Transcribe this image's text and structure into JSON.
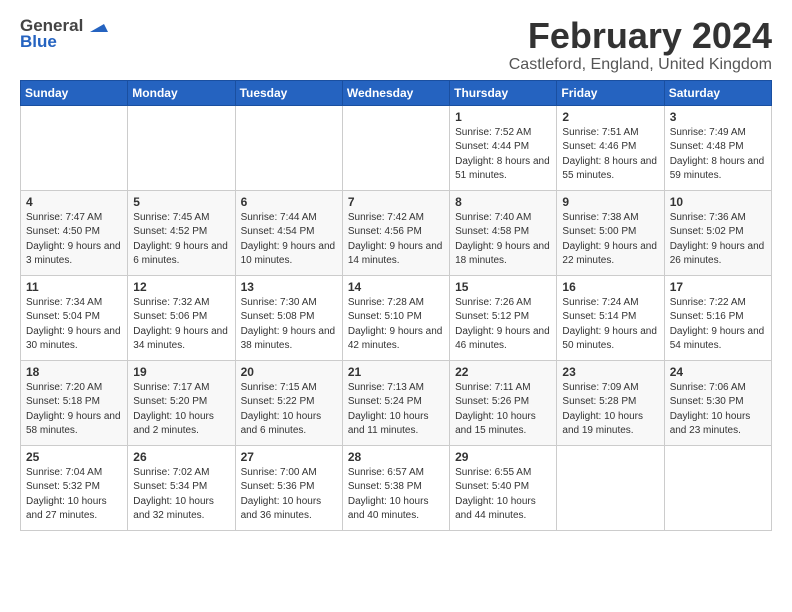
{
  "logo": {
    "general": "General",
    "blue": "Blue"
  },
  "title": "February 2024",
  "subtitle": "Castleford, England, United Kingdom",
  "days_of_week": [
    "Sunday",
    "Monday",
    "Tuesday",
    "Wednesday",
    "Thursday",
    "Friday",
    "Saturday"
  ],
  "weeks": [
    [
      {
        "day": "",
        "info": ""
      },
      {
        "day": "",
        "info": ""
      },
      {
        "day": "",
        "info": ""
      },
      {
        "day": "",
        "info": ""
      },
      {
        "day": "1",
        "info": "Sunrise: 7:52 AM\nSunset: 4:44 PM\nDaylight: 8 hours and 51 minutes."
      },
      {
        "day": "2",
        "info": "Sunrise: 7:51 AM\nSunset: 4:46 PM\nDaylight: 8 hours and 55 minutes."
      },
      {
        "day": "3",
        "info": "Sunrise: 7:49 AM\nSunset: 4:48 PM\nDaylight: 8 hours and 59 minutes."
      }
    ],
    [
      {
        "day": "4",
        "info": "Sunrise: 7:47 AM\nSunset: 4:50 PM\nDaylight: 9 hours and 3 minutes."
      },
      {
        "day": "5",
        "info": "Sunrise: 7:45 AM\nSunset: 4:52 PM\nDaylight: 9 hours and 6 minutes."
      },
      {
        "day": "6",
        "info": "Sunrise: 7:44 AM\nSunset: 4:54 PM\nDaylight: 9 hours and 10 minutes."
      },
      {
        "day": "7",
        "info": "Sunrise: 7:42 AM\nSunset: 4:56 PM\nDaylight: 9 hours and 14 minutes."
      },
      {
        "day": "8",
        "info": "Sunrise: 7:40 AM\nSunset: 4:58 PM\nDaylight: 9 hours and 18 minutes."
      },
      {
        "day": "9",
        "info": "Sunrise: 7:38 AM\nSunset: 5:00 PM\nDaylight: 9 hours and 22 minutes."
      },
      {
        "day": "10",
        "info": "Sunrise: 7:36 AM\nSunset: 5:02 PM\nDaylight: 9 hours and 26 minutes."
      }
    ],
    [
      {
        "day": "11",
        "info": "Sunrise: 7:34 AM\nSunset: 5:04 PM\nDaylight: 9 hours and 30 minutes."
      },
      {
        "day": "12",
        "info": "Sunrise: 7:32 AM\nSunset: 5:06 PM\nDaylight: 9 hours and 34 minutes."
      },
      {
        "day": "13",
        "info": "Sunrise: 7:30 AM\nSunset: 5:08 PM\nDaylight: 9 hours and 38 minutes."
      },
      {
        "day": "14",
        "info": "Sunrise: 7:28 AM\nSunset: 5:10 PM\nDaylight: 9 hours and 42 minutes."
      },
      {
        "day": "15",
        "info": "Sunrise: 7:26 AM\nSunset: 5:12 PM\nDaylight: 9 hours and 46 minutes."
      },
      {
        "day": "16",
        "info": "Sunrise: 7:24 AM\nSunset: 5:14 PM\nDaylight: 9 hours and 50 minutes."
      },
      {
        "day": "17",
        "info": "Sunrise: 7:22 AM\nSunset: 5:16 PM\nDaylight: 9 hours and 54 minutes."
      }
    ],
    [
      {
        "day": "18",
        "info": "Sunrise: 7:20 AM\nSunset: 5:18 PM\nDaylight: 9 hours and 58 minutes."
      },
      {
        "day": "19",
        "info": "Sunrise: 7:17 AM\nSunset: 5:20 PM\nDaylight: 10 hours and 2 minutes."
      },
      {
        "day": "20",
        "info": "Sunrise: 7:15 AM\nSunset: 5:22 PM\nDaylight: 10 hours and 6 minutes."
      },
      {
        "day": "21",
        "info": "Sunrise: 7:13 AM\nSunset: 5:24 PM\nDaylight: 10 hours and 11 minutes."
      },
      {
        "day": "22",
        "info": "Sunrise: 7:11 AM\nSunset: 5:26 PM\nDaylight: 10 hours and 15 minutes."
      },
      {
        "day": "23",
        "info": "Sunrise: 7:09 AM\nSunset: 5:28 PM\nDaylight: 10 hours and 19 minutes."
      },
      {
        "day": "24",
        "info": "Sunrise: 7:06 AM\nSunset: 5:30 PM\nDaylight: 10 hours and 23 minutes."
      }
    ],
    [
      {
        "day": "25",
        "info": "Sunrise: 7:04 AM\nSunset: 5:32 PM\nDaylight: 10 hours and 27 minutes."
      },
      {
        "day": "26",
        "info": "Sunrise: 7:02 AM\nSunset: 5:34 PM\nDaylight: 10 hours and 32 minutes."
      },
      {
        "day": "27",
        "info": "Sunrise: 7:00 AM\nSunset: 5:36 PM\nDaylight: 10 hours and 36 minutes."
      },
      {
        "day": "28",
        "info": "Sunrise: 6:57 AM\nSunset: 5:38 PM\nDaylight: 10 hours and 40 minutes."
      },
      {
        "day": "29",
        "info": "Sunrise: 6:55 AM\nSunset: 5:40 PM\nDaylight: 10 hours and 44 minutes."
      },
      {
        "day": "",
        "info": ""
      },
      {
        "day": "",
        "info": ""
      }
    ]
  ]
}
